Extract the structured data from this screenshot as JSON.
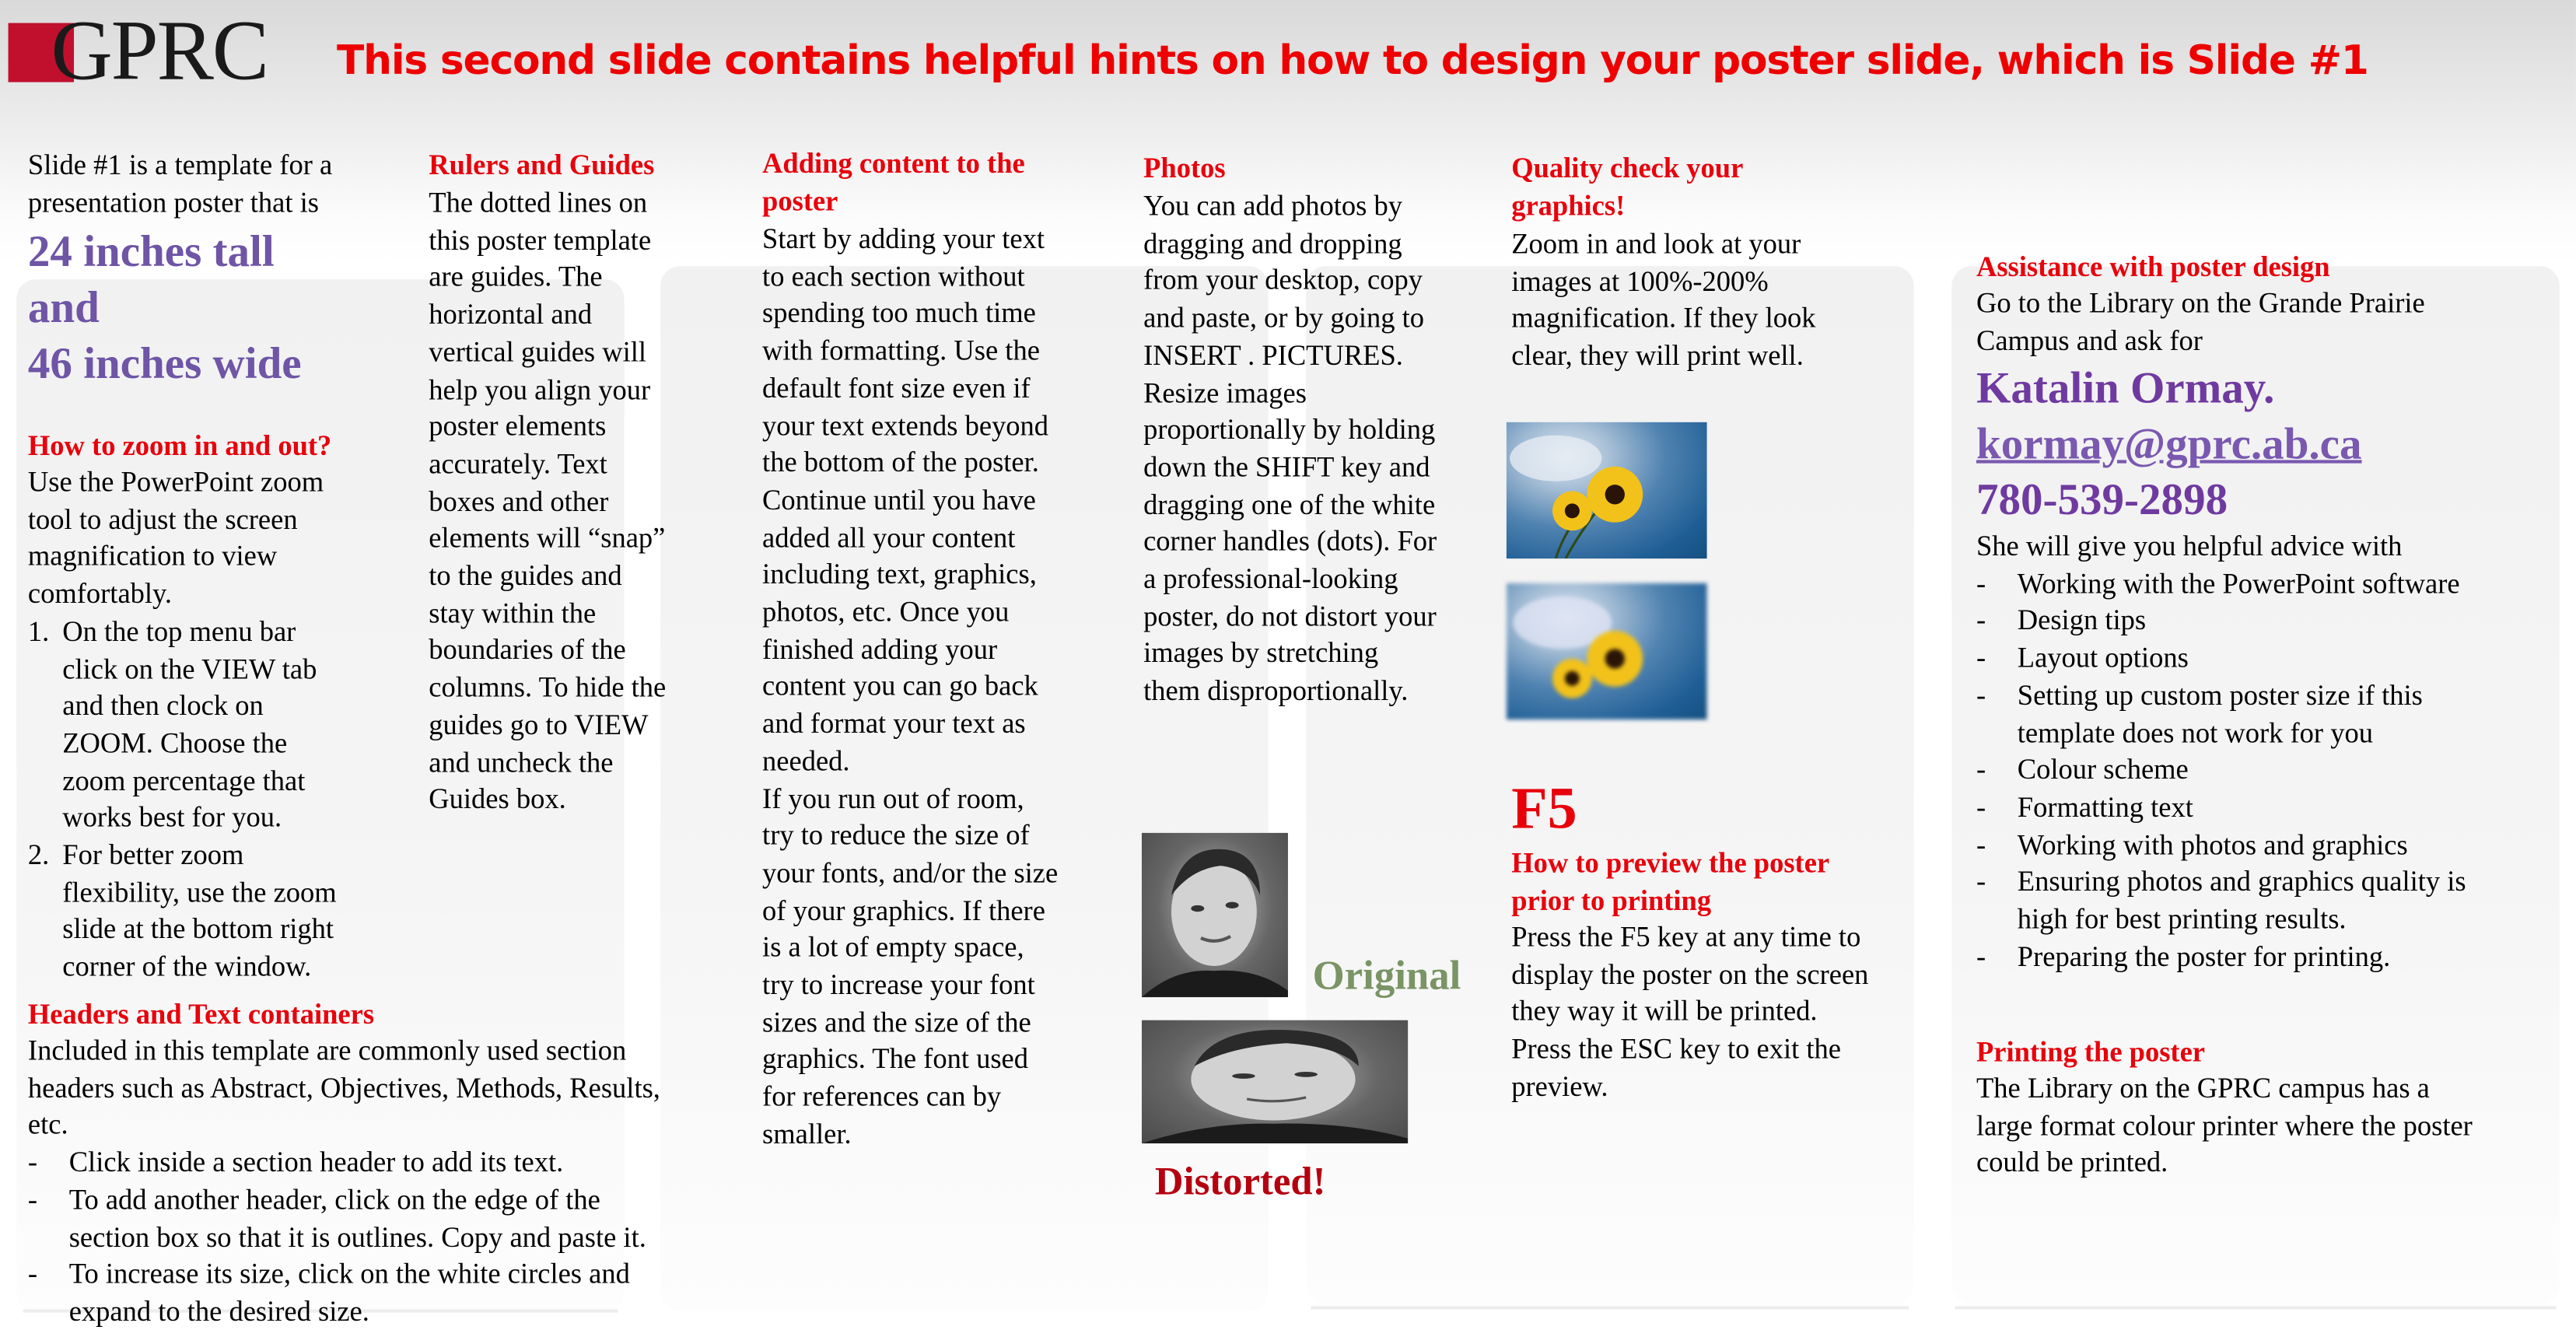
{
  "header": {
    "logo_text": "GPRC",
    "title": "This second slide contains helpful hints on how to design your poster slide, which is Slide #1"
  },
  "colors": {
    "heading_red": "#e8000b",
    "title_red": "#ee0000",
    "accent_purple": "#6e55a6",
    "contact_purple": "#6f3aa0",
    "original_green": "#7a9465",
    "distorted_red": "#b5000f",
    "logo_red": "#c0102e"
  },
  "col1": {
    "intro_lines": [
      "Slide #1 is a template for a",
      "presentation poster that is"
    ],
    "size_lines": [
      "24 inches tall",
      "and",
      "46 inches wide"
    ],
    "zoom_heading": "How to zoom in and out?",
    "zoom_lines": [
      "Use the PowerPoint zoom",
      "tool to adjust the screen",
      "magnification to view",
      "comfortably."
    ],
    "zoom_steps": [
      {
        "marker": "1.",
        "lines": [
          "On the top menu bar",
          "click on the VIEW tab",
          "and then clock on",
          "ZOOM. Choose the",
          "zoom percentage that",
          "works best for you."
        ]
      },
      {
        "marker": "2.",
        "lines": [
          "For better zoom",
          "flexibility, use the zoom",
          "slide at the bottom right",
          "corner of the window."
        ]
      }
    ],
    "headers_heading": "Headers and Text containers",
    "headers_lines": [
      "Included in this template are commonly used section",
      "headers such as Abstract, Objectives, Methods, Results,",
      "etc."
    ],
    "headers_bullets": [
      {
        "marker": "-",
        "lines": [
          "Click inside a section header to add its text."
        ]
      },
      {
        "marker": "-",
        "lines": [
          "To add another header, click on the edge of the",
          "section box so that it is outlines. Copy and paste it."
        ]
      },
      {
        "marker": "-",
        "lines": [
          "To increase its size, click on the white circles and",
          "expand to the desired size."
        ]
      }
    ]
  },
  "col2": {
    "heading": "Rulers and Guides",
    "lines": [
      "The dotted lines on",
      "this poster template",
      "are guides. The",
      "horizontal and",
      "vertical guides will",
      "help you align your",
      "poster elements",
      "accurately. Text",
      "boxes and other",
      "elements will “snap”",
      "to the guides and",
      "stay within the",
      "boundaries of the",
      "columns. To hide the",
      "guides go to VIEW",
      "and uncheck the",
      "Guides box."
    ]
  },
  "col3": {
    "heading_lines": [
      "Adding content to the",
      "poster"
    ],
    "lines": [
      "Start by adding your text",
      "to each section without",
      "spending too much time",
      "with formatting. Use the",
      "default font size even if",
      "your text extends beyond",
      "the bottom of the poster.",
      "Continue until you have",
      "added all your content",
      "including text, graphics,",
      "photos, etc. Once you",
      "finished adding your",
      "content you can go back",
      "and format your text as",
      "needed.",
      "If you run out of room,",
      "try to reduce the size of",
      "your fonts, and/or the size",
      "of your graphics. If there",
      "is a lot of empty space,",
      "try to increase your font",
      "sizes and the size of the",
      "graphics. The font used",
      "for references can by",
      "smaller."
    ]
  },
  "col4": {
    "heading": "Photos",
    "lines": [
      "You can add photos by",
      "dragging and dropping",
      "from your desktop, copy",
      "and paste, or by going to",
      "INSERT . PICTURES.",
      "Resize images",
      "proportionally by holding",
      "down the SHIFT key and",
      "dragging one of the white",
      "corner handles (dots). For",
      "a professional-looking",
      "poster, do not distort your",
      "images by stretching",
      "them disproportionally."
    ],
    "original_label": "Original",
    "distorted_label": "Distorted!"
  },
  "col5": {
    "heading_lines": [
      "Quality check your",
      "graphics!"
    ],
    "lines": [
      "Zoom in and look at your",
      "images at 100%-200%",
      "magnification. If they look",
      "clear, they will print well."
    ],
    "f5_label": "F5",
    "preview_heading_lines": [
      "How to preview the poster",
      "prior to printing"
    ],
    "preview_lines": [
      "Press the F5 key at any time to",
      "display the poster on the screen",
      "they way it will be printed.",
      "Press the ESC key to exit the",
      "preview."
    ]
  },
  "col6": {
    "heading": "Assistance with poster design",
    "intro_lines": [
      "Go to the Library on the Grande Prairie",
      "Campus and ask for"
    ],
    "contact_name": "Katalin Ormay.",
    "contact_email": "kormay@gprc.ab.ca",
    "contact_phone": "780-539-2898",
    "advice_intro": "She will give you helpful advice with",
    "advice_items": [
      {
        "marker": "-",
        "lines": [
          "Working with the PowerPoint software"
        ]
      },
      {
        "marker": "-",
        "lines": [
          "Design tips"
        ]
      },
      {
        "marker": "-",
        "lines": [
          "Layout options"
        ]
      },
      {
        "marker": "-",
        "lines": [
          "Setting up custom poster size if this",
          "template does not work for you"
        ]
      },
      {
        "marker": "-",
        "lines": [
          "Colour scheme"
        ]
      },
      {
        "marker": "-",
        "lines": [
          "Formatting text"
        ]
      },
      {
        "marker": "-",
        "lines": [
          "Working with photos and graphics"
        ]
      },
      {
        "marker": "-",
        "lines": [
          "Ensuring photos and graphics quality is",
          "high for best printing results."
        ]
      },
      {
        "marker": "-",
        "lines": [
          "Preparing the poster for printing."
        ]
      }
    ],
    "printing_heading": "Printing the poster",
    "printing_lines": [
      "The Library on the GPRC campus has a",
      "large format colour printer where the poster",
      "could be printed."
    ]
  }
}
